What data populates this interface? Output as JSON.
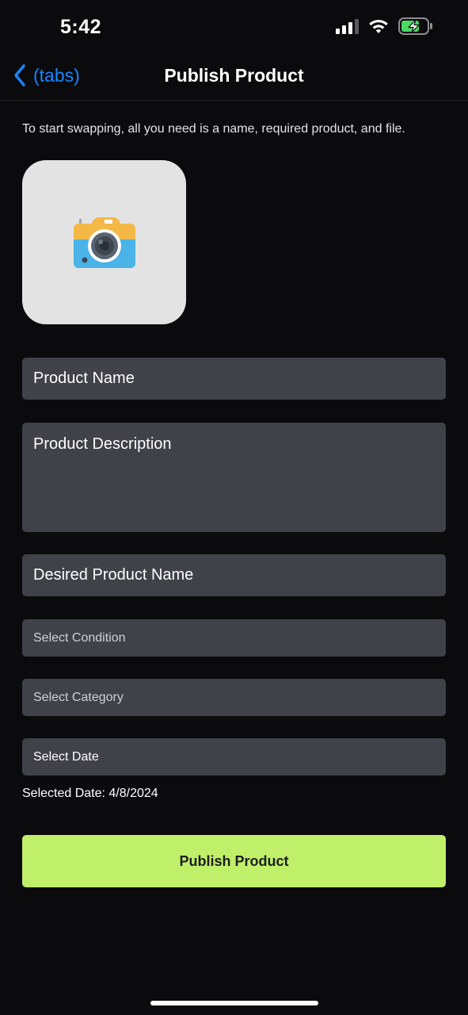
{
  "status_bar": {
    "time": "5:42",
    "icons": [
      "cellular-signal-icon",
      "wifi-icon",
      "battery-charging-icon"
    ]
  },
  "nav": {
    "back_label": "(tabs)",
    "title": "Publish Product"
  },
  "intro_text": "To start swapping, all you need is a name, required product, and file.",
  "image_picker": {
    "icon": "camera-icon"
  },
  "form": {
    "product_name_placeholder": "Product Name",
    "product_description_placeholder": "Product Description",
    "desired_product_placeholder": "Desired Product Name",
    "condition_label": "Select Condition",
    "category_label": "Select Category",
    "date_label": "Select Date",
    "selected_date_text": "Selected Date: 4/8/2024"
  },
  "publish_button_label": "Publish Product",
  "colors": {
    "background": "#0b0b0d",
    "field": "#41414a",
    "accent_link": "#1a84ff",
    "publish_button": "#c0ef6a",
    "battery_charge": "#4cd964"
  }
}
